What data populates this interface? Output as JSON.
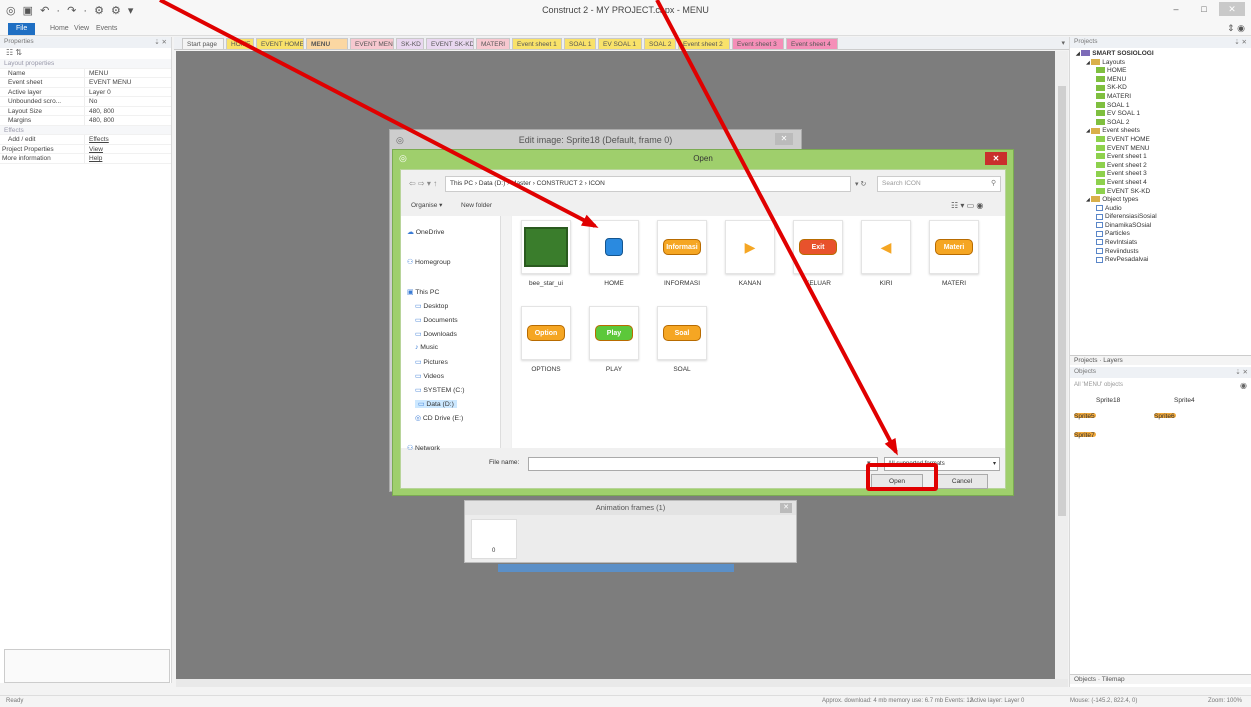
{
  "app": {
    "title": "Construct 2 - MY PROJECT.capx - MENU",
    "quick_access": "◎ ▣ ↶ · ↷ · ⚙ ⚙ ▾",
    "window_controls": [
      "–",
      "□",
      "✕"
    ]
  },
  "ribbon": {
    "tabs": [
      "File",
      "Home",
      "View",
      "Events"
    ],
    "right_icons": "⇕ ◉"
  },
  "properties": {
    "header": "Properties",
    "header_icons": "⇣ ✕",
    "toolbar": "☷ ⇅",
    "categories": {
      "layout": "Layout properties",
      "effects": "Effects"
    },
    "rows": [
      {
        "k": "Name",
        "v": "MENU"
      },
      {
        "k": "Event sheet",
        "v": "EVENT MENU"
      },
      {
        "k": "Active layer",
        "v": "Layer 0"
      },
      {
        "k": "Unbounded scro...",
        "v": "No"
      },
      {
        "k": "Layout Size",
        "v": "480, 800"
      },
      {
        "k": "Margins",
        "v": "480, 800"
      }
    ],
    "effects_row": {
      "k": "Add / edit",
      "v": "Effects"
    },
    "project_props": {
      "k": "Project Properties",
      "v": "View"
    },
    "more_info": {
      "k": "More information",
      "v": "Help"
    }
  },
  "doc_tabs": [
    {
      "label": "Start page",
      "bg": "#f4f4f4"
    },
    {
      "label": "HOME",
      "bg": "#f9e26a"
    },
    {
      "label": "EVENT HOME",
      "bg": "#f9e26a"
    },
    {
      "label": "MENU",
      "bg": "#fbd7a2"
    },
    {
      "label": "EVENT MENU",
      "bg": "#f7c8d0"
    },
    {
      "label": "SK-KD",
      "bg": "#e9d7f0"
    },
    {
      "label": "EVENT SK-KD",
      "bg": "#e9d7f0"
    },
    {
      "label": "MATERI",
      "bg": "#f7c8d0"
    },
    {
      "label": "Event sheet 1",
      "bg": "#f9e26a"
    },
    {
      "label": "SOAL 1",
      "bg": "#f9e26a"
    },
    {
      "label": "EV SOAL 1",
      "bg": "#f9e26a"
    },
    {
      "label": "SOAL 2",
      "bg": "#f9e26a"
    },
    {
      "label": "Event sheet 2",
      "bg": "#f9e26a"
    },
    {
      "label": "Event sheet 3",
      "bg": "#f58fb8"
    },
    {
      "label": "Event sheet 4",
      "bg": "#f58fb8"
    }
  ],
  "projects": {
    "header": "Projects",
    "tree": [
      {
        "label": "SMART SOSIOLOGI",
        "icon": "root",
        "depth": 0
      },
      {
        "label": "Layouts",
        "icon": "folder",
        "depth": 1
      },
      {
        "label": "HOME",
        "icon": "lay",
        "depth": 2
      },
      {
        "label": "MENU",
        "icon": "lay",
        "depth": 2
      },
      {
        "label": "SK-KD",
        "icon": "lay",
        "depth": 2
      },
      {
        "label": "MATERI",
        "icon": "lay",
        "depth": 2
      },
      {
        "label": "SOAL 1",
        "icon": "lay",
        "depth": 2
      },
      {
        "label": "EV SOAL 1",
        "icon": "lay",
        "depth": 2
      },
      {
        "label": "SOAL 2",
        "icon": "lay",
        "depth": 2
      },
      {
        "label": "Event sheets",
        "icon": "folder",
        "depth": 1
      },
      {
        "label": "EVENT HOME",
        "icon": "ev",
        "depth": 2
      },
      {
        "label": "EVENT MENU",
        "icon": "ev",
        "depth": 2
      },
      {
        "label": "Event sheet 1",
        "icon": "ev",
        "depth": 2
      },
      {
        "label": "Event sheet 2",
        "icon": "ev",
        "depth": 2
      },
      {
        "label": "Event sheet 3",
        "icon": "ev",
        "depth": 2
      },
      {
        "label": "Event sheet 4",
        "icon": "ev",
        "depth": 2
      },
      {
        "label": "EVENT SK-KD",
        "icon": "ev",
        "depth": 2
      },
      {
        "label": "Object types",
        "icon": "folder",
        "depth": 1
      },
      {
        "label": "Audio",
        "icon": "obj",
        "depth": 2
      },
      {
        "label": "DiferensiasiSosial",
        "icon": "obj",
        "depth": 2
      },
      {
        "label": "DinamikaSOsial",
        "icon": "obj",
        "depth": 2
      },
      {
        "label": "Particles",
        "icon": "obj",
        "depth": 2
      },
      {
        "label": "RevIntsiats",
        "icon": "obj",
        "depth": 2
      },
      {
        "label": "Reviindusts",
        "icon": "obj",
        "depth": 2
      },
      {
        "label": "RevPesadalvai",
        "icon": "obj",
        "depth": 2
      }
    ],
    "bottom_tabs": [
      "Projects",
      "Layers"
    ]
  },
  "objects": {
    "header": "Objects",
    "filter": "All 'MENU' objects",
    "items": [
      "Sprite18",
      "Sprite4",
      "Sprite5",
      "Sprite6",
      "Sprite7"
    ],
    "bottom_tabs": [
      "Objects",
      "Tilemap"
    ]
  },
  "status": {
    "ready": "Ready",
    "approx": "Approx. download: 4 mb  memory use: 6.7 mb  Events: 12",
    "layer": "Active layer: Layer 0",
    "mouse": "Mouse: (-145.2, 822.4, 0)",
    "zoom": "Zoom: 100%"
  },
  "edit_image": {
    "title": "Edit image: Sprite18 (Default, frame 0)",
    "close": "✕"
  },
  "animation": {
    "title": "Animation frames (1)",
    "frame": "0"
  },
  "open_dialog": {
    "title": "Open",
    "close": "✕",
    "path": "This PC  ›  Data (D:)  ›  Master  ›  CONSTRUCT 2  ›  ICON",
    "search_placeholder": "Search ICON",
    "organise": "Organise ▾",
    "new_folder": "New folder",
    "nav": [
      {
        "label": "OneDrive",
        "icon": "☁"
      },
      {
        "label": "Homegroup",
        "icon": "⚇"
      },
      {
        "label": "This PC",
        "icon": "▣"
      },
      {
        "label": "Desktop",
        "icon": "▭"
      },
      {
        "label": "Documents",
        "icon": "▭"
      },
      {
        "label": "Downloads",
        "icon": "▭"
      },
      {
        "label": "Music",
        "icon": "♪"
      },
      {
        "label": "Pictures",
        "icon": "▭"
      },
      {
        "label": "Videos",
        "icon": "▭"
      },
      {
        "label": "SYSTEM (C:)",
        "icon": "▭"
      },
      {
        "label": "Data (D:)",
        "icon": "▭"
      },
      {
        "label": "CD Drive (E:)",
        "icon": "◎"
      },
      {
        "label": "Network",
        "icon": "⚇"
      }
    ],
    "files": [
      {
        "name": "bee_star_ui",
        "kind": "sheet"
      },
      {
        "name": "HOME",
        "kind": "home"
      },
      {
        "name": "INFORMASI",
        "kind": "btn",
        "text": "Informasi",
        "color": "#f5a623"
      },
      {
        "name": "KANAN",
        "kind": "arrow",
        "text": "▶",
        "color": "#f5a623"
      },
      {
        "name": "KELUAR",
        "kind": "btn",
        "text": "Exit",
        "color": "#e8522c"
      },
      {
        "name": "KIRI",
        "kind": "arrow",
        "text": "◀",
        "color": "#f5a623"
      },
      {
        "name": "MATERI",
        "kind": "btn",
        "text": "Materi",
        "color": "#f5a623"
      },
      {
        "name": "OPTIONS",
        "kind": "btn",
        "text": "Option",
        "color": "#f5a623"
      },
      {
        "name": "PLAY",
        "kind": "btn",
        "text": "Play",
        "color": "#5cc83a"
      },
      {
        "name": "SOAL",
        "kind": "btn",
        "text": "Soal",
        "color": "#f5a623"
      }
    ],
    "filename_label": "File name:",
    "filename_value": "",
    "format": "All supported formats",
    "open_btn": "Open",
    "cancel_btn": "Cancel"
  }
}
